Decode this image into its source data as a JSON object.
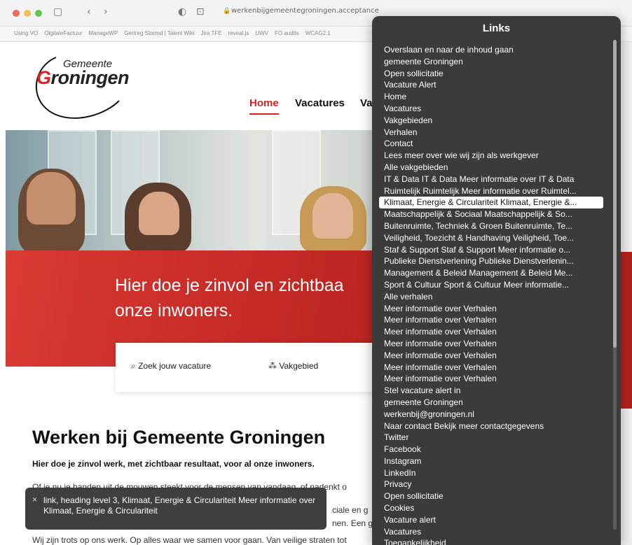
{
  "browser": {
    "url": "werkenbijgemeentegroningen.acceptance",
    "bookmarks": [
      "Using VO",
      "OlgitaleFactuur",
      "ManageWP",
      "Gertreg Stormd | Talent Wiki",
      "Jira TFE",
      "reveal.js",
      "UWV",
      "FO audits",
      "WCAG2.1"
    ],
    "sidebar_icon": "▢",
    "back_icon": "‹",
    "forward_icon": "›",
    "shield_icon": "◐",
    "tab_icon": "⊡"
  },
  "site": {
    "logo_top": "Gemeente",
    "logo_g": "G",
    "logo_rest": "roningen",
    "nav": {
      "home": "Home",
      "vacatures": "Vacatures",
      "vak": "Va"
    },
    "hero_title": "Hier doe je zinvol en zichtbaa onze inwoners.",
    "search": {
      "zoek": "Zoek jouw vacature",
      "vakgebied": "Vakgebied"
    },
    "heading": "Werken bij Gemeente Groningen",
    "lead": "Hier doe je zinvol werk, met zichtbaar resultaat, voor al onze inwoners.",
    "p1": "Of je nu je handen uit de mouwen steekt voor de mensen van vandaag, of nadenkt o",
    "p2": "ciale en g",
    "p3": "nen. Een g",
    "p4": "Wij zijn trots op ons werk. Op alles waar we samen voor gaan. Van veilige straten tot"
  },
  "voiceover": {
    "close": "×",
    "caption": "link, heading level 3, Klimaat, Energie & Circulariteit Meer informatie over Klimaat, Energie & Circulariteit"
  },
  "rotor": {
    "title": "Links",
    "selected_index": 13,
    "items": [
      "Overslaan en naar de inhoud gaan",
      "gemeente Groningen",
      "Open sollicitatie",
      "Vacature Alert",
      "Home",
      "Vacatures",
      "Vakgebieden",
      "Verhalen",
      "Contact",
      "Lees meer over wie wij zijn als werkgever",
      "Alle vakgebieden",
      "IT & Data IT & Data Meer informatie over IT & Data",
      "Ruimtelijk Ruimtelijk Meer informatie over Ruimtel...",
      "Klimaat, Energie & Circulariteit Klimaat, Energie &...",
      "Maatschappelijk & Sociaal Maatschappelijk & So...",
      "Buitenruimte, Techniek & Groen Buitenruimte, Te...",
      "Veiligheid, Toezicht & Handhaving Veiligheid, Toe...",
      "Staf & Support Staf & Support Meer informatie o...",
      "Publieke Dienstverlening Publieke Dienstverlenin...",
      "Management & Beleid Management & Beleid Me...",
      "Sport & Cultuur Sport & Cultuur Meer informatie...",
      "Alle verhalen",
      "Meer informatie over Verhalen",
      "Meer informatie over Verhalen",
      "Meer informatie over Verhalen",
      "Meer informatie over Verhalen",
      "Meer informatie over Verhalen",
      "Meer informatie over Verhalen",
      "Meer informatie over Verhalen",
      "Stel vacature alert in",
      "gemeente Groningen",
      "werkenbij@groningen.nl",
      "Naar contact Bekijk meer contactgegevens",
      "Twitter",
      "Facebook",
      "Instagram",
      "LinkedIn",
      "Privacy",
      "Open sollicitatie",
      "Cookies",
      "Vacature alert",
      "Vacatures",
      "Toegankelijkheid"
    ]
  },
  "colors": {
    "brand_red": "#e02020",
    "rotor_bg": "#3b3b3b"
  }
}
